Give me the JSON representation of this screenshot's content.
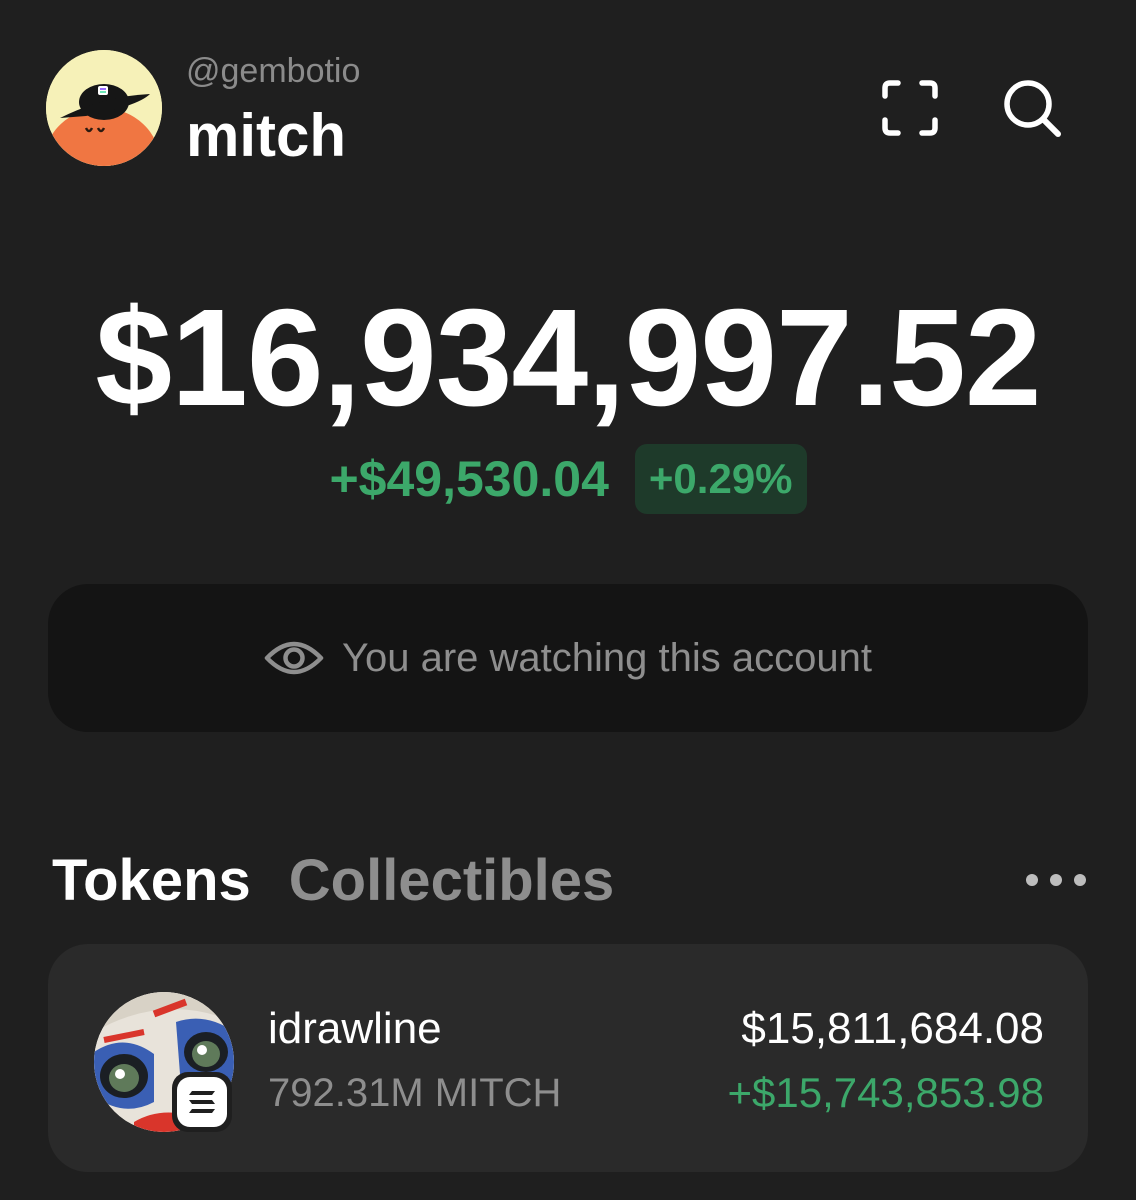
{
  "header": {
    "handle": "@gembotio",
    "username": "mitch",
    "avatar_icon": "orange-blob-with-black-cap-avatar",
    "scan_icon": "scan-frame-icon",
    "search_icon": "search-icon"
  },
  "balance": {
    "total": "$16,934,997.52",
    "change_value": "+$49,530.04",
    "change_percent": "+0.29%"
  },
  "watch_banner": {
    "icon": "eye-icon",
    "text": "You are watching this account"
  },
  "tabs": [
    {
      "label": "Tokens",
      "active": true
    },
    {
      "label": "Collectibles",
      "active": false
    }
  ],
  "more_icon": "more-horizontal-icon",
  "tokens": [
    {
      "name": "idrawline",
      "amount": "792.31M MITCH",
      "value": "$15,811,684.08",
      "change": "+$15,743,853.98",
      "chain_icon": "solana-icon"
    }
  ],
  "colors": {
    "background": "#1f1f1f",
    "card": "#2a2a2a",
    "banner": "#141414",
    "positive": "#3ca86a",
    "positive_bg": "#1e3a2a",
    "muted_text": "#8e8e8e"
  }
}
